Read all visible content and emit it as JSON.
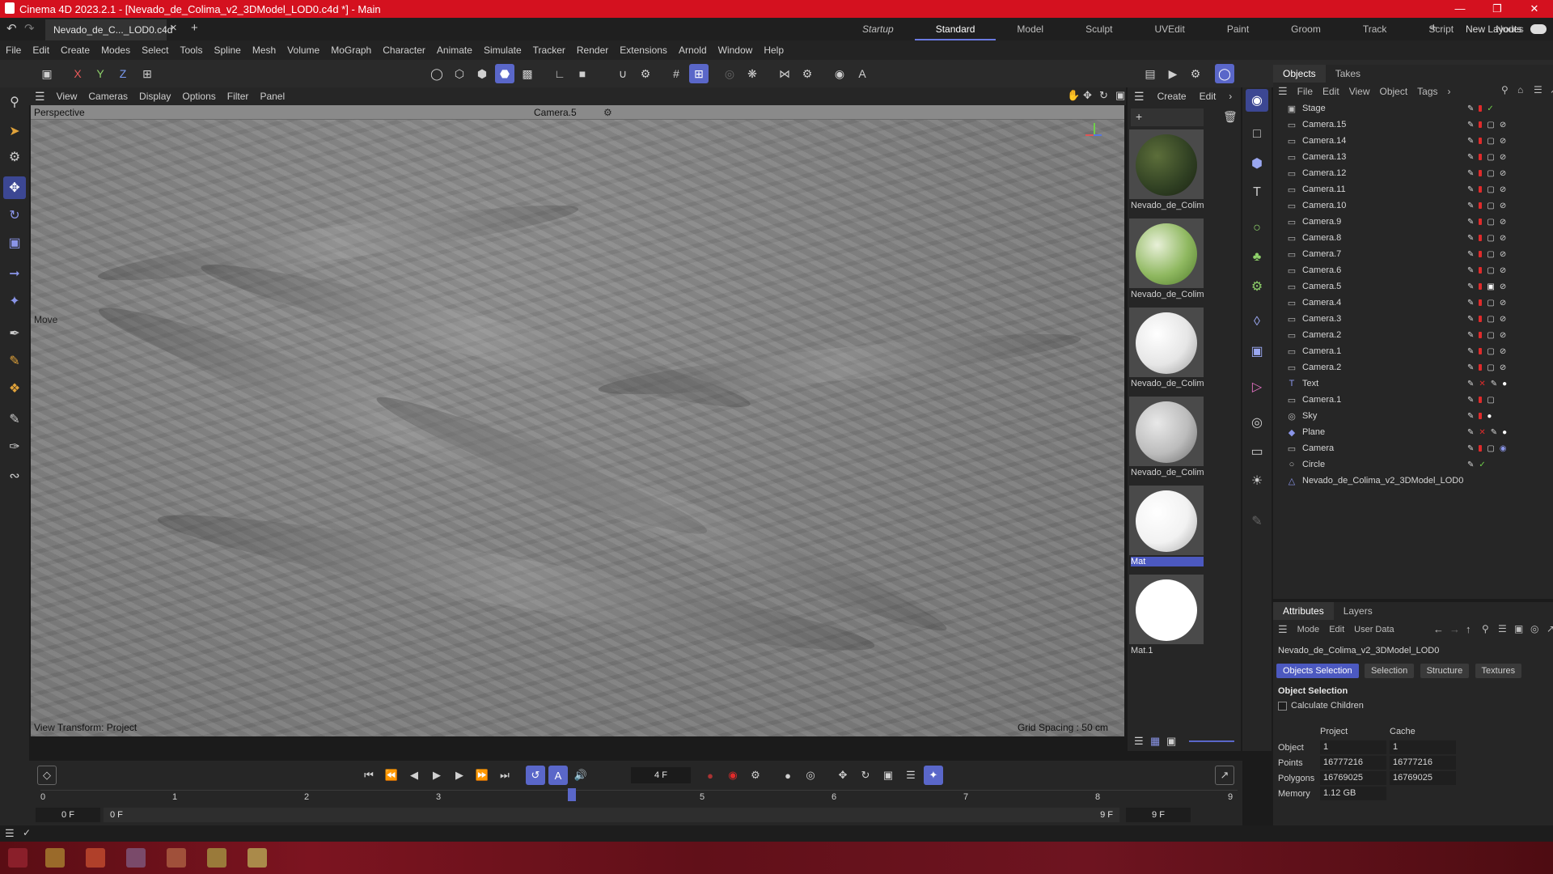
{
  "window": {
    "title": "Cinema 4D 2023.2.1 - [Nevado_de_Colima_v2_3DModel_LOD0.c4d *] - Main"
  },
  "doc_tab": {
    "label": "Nevado_de_C..._LOD0.c4d *"
  },
  "layouts": [
    "Startup",
    "Standard",
    "Model",
    "Sculpt",
    "UVEdit",
    "Paint",
    "Groom",
    "Track",
    "Script",
    "Nodes"
  ],
  "layouts_active": "Standard",
  "new_layouts": "New Layouts",
  "menu": [
    "File",
    "Edit",
    "Create",
    "Modes",
    "Select",
    "Tools",
    "Spline",
    "Mesh",
    "Volume",
    "MoGraph",
    "Character",
    "Animate",
    "Simulate",
    "Tracker",
    "Render",
    "Extensions",
    "Arnold",
    "Window",
    "Help"
  ],
  "axis_buttons": [
    "X",
    "Y",
    "Z"
  ],
  "viewport": {
    "menu": [
      "View",
      "Cameras",
      "Display",
      "Options",
      "Filter",
      "Panel"
    ],
    "perspective_label": "Perspective",
    "camera_label": "Camera.5",
    "move_label": "Move",
    "view_transform": "View Transform: Project",
    "grid_spacing": "Grid Spacing : 50 cm"
  },
  "material_manager": {
    "menu": [
      "Create",
      "Edit"
    ],
    "materials": [
      {
        "name": "Nevado_de_Colim",
        "ball_color": "#2f3f22"
      },
      {
        "name": "Nevado_de_Colim",
        "ball_color": "#8fb860"
      },
      {
        "name": "Nevado_de_Colim",
        "ball_color": "#e6e6e6"
      },
      {
        "name": "Nevado_de_Colim",
        "ball_color": "#bcbcbc"
      },
      {
        "name": "Mat",
        "ball_color": "#f2f2f2"
      },
      {
        "name": "Mat.1",
        "ball_color": "#ffffff"
      }
    ]
  },
  "objects_panel": {
    "tabs": [
      "Objects",
      "Takes"
    ],
    "menu": [
      "File",
      "Edit",
      "View",
      "Object",
      "Tags"
    ],
    "items": [
      {
        "name": "Stage",
        "icon": "stage-icon"
      },
      {
        "name": "Camera.15",
        "icon": "camera-icon"
      },
      {
        "name": "Camera.14",
        "icon": "camera-icon"
      },
      {
        "name": "Camera.13",
        "icon": "camera-icon"
      },
      {
        "name": "Camera.12",
        "icon": "camera-icon"
      },
      {
        "name": "Camera.11",
        "icon": "camera-icon"
      },
      {
        "name": "Camera.10",
        "icon": "camera-icon"
      },
      {
        "name": "Camera.9",
        "icon": "camera-icon"
      },
      {
        "name": "Camera.8",
        "icon": "camera-icon"
      },
      {
        "name": "Camera.7",
        "icon": "camera-icon"
      },
      {
        "name": "Camera.6",
        "icon": "camera-icon"
      },
      {
        "name": "Camera.5",
        "icon": "camera-icon"
      },
      {
        "name": "Camera.4",
        "icon": "camera-icon"
      },
      {
        "name": "Camera.3",
        "icon": "camera-icon"
      },
      {
        "name": "Camera.2",
        "icon": "camera-icon"
      },
      {
        "name": "Camera.1",
        "icon": "camera-icon"
      },
      {
        "name": "Camera.2",
        "icon": "camera-icon"
      },
      {
        "name": "Text",
        "icon": "text-icon"
      },
      {
        "name": "Camera.1",
        "icon": "camera-icon"
      },
      {
        "name": "Sky",
        "icon": "sky-icon"
      },
      {
        "name": "Plane",
        "icon": "plane-icon"
      },
      {
        "name": "Camera",
        "icon": "camera-icon"
      },
      {
        "name": "Circle",
        "icon": "circle-icon"
      },
      {
        "name": "Nevado_de_Colima_v2_3DModel_LOD0",
        "icon": "polygon-icon"
      }
    ]
  },
  "attributes": {
    "tabs": [
      "Attributes",
      "Layers"
    ],
    "menu": [
      "Mode",
      "Edit",
      "User Data"
    ],
    "object_name": "Nevado_de_Colima_v2_3DModel_LOD0",
    "sub_tabs": [
      "Objects Selection",
      "Selection",
      "Structure",
      "Textures"
    ],
    "section_title": "Object Selection",
    "calculate_children": "Calculate Children",
    "col_headers": [
      "Project",
      "Cache"
    ],
    "rows": [
      {
        "label": "Object",
        "project": "1",
        "cache": "1"
      },
      {
        "label": "Points",
        "project": "16777216",
        "cache": "16777216"
      },
      {
        "label": "Polygons",
        "project": "16769025",
        "cache": "16769025"
      },
      {
        "label": "Memory",
        "project": "1.12 GB",
        "cache": ""
      }
    ]
  },
  "timeline": {
    "current_frame": "4 F",
    "ticks": [
      "0",
      "1",
      "2",
      "3",
      "4",
      "5",
      "6",
      "7",
      "8",
      "9"
    ],
    "start_field": "0 F",
    "range_start": "0 F",
    "range_end": "9 F",
    "end_field": "9 F"
  },
  "colors": {
    "title_bar": "#d4111f",
    "accent": "#5a67c9"
  }
}
